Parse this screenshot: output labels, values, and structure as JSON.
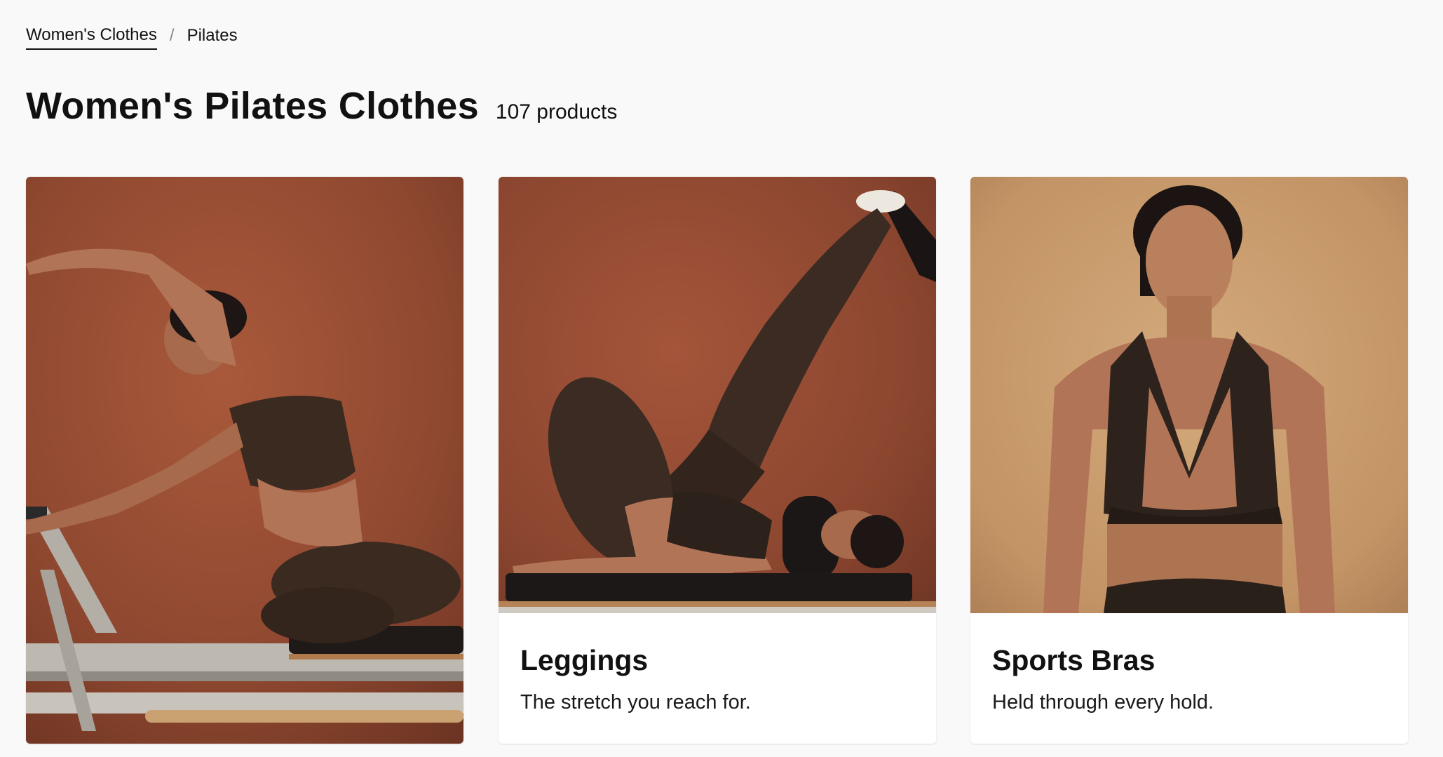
{
  "breadcrumb": {
    "parent": "Women's Clothes",
    "separator": "/",
    "current": "Pilates"
  },
  "header": {
    "title": "Women's Pilates Clothes",
    "count": "107 products"
  },
  "cards": [
    {
      "image": "woman-side-stretch-on-reformer-photo",
      "heading": "",
      "tagline": ""
    },
    {
      "image": "woman-leg-raise-on-reformer-photo",
      "heading": "Leggings",
      "tagline": "The stretch you reach for."
    },
    {
      "image": "woman-in-sports-bra-portrait-photo",
      "heading": "Sports Bras",
      "tagline": "Held through every hold."
    }
  ],
  "colors": {
    "background": "#f9f9f9",
    "text": "#111111",
    "photo_terracotta": "#9a4e33",
    "photo_sand": "#c79a6c",
    "garment_brown": "#3a2a20"
  }
}
